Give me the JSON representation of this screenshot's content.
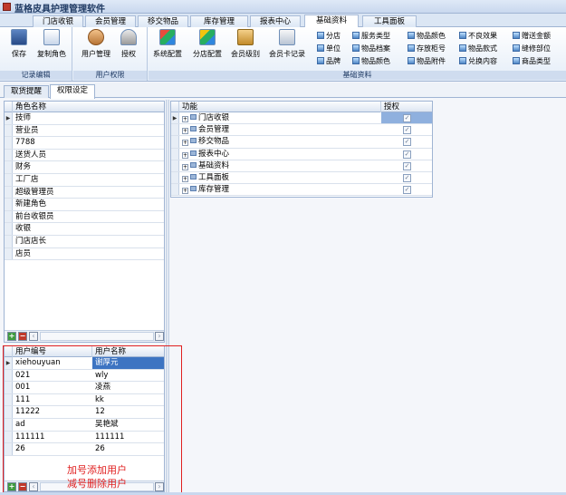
{
  "window": {
    "title": "蓝格皮具护理管理软件"
  },
  "menu_tabs": [
    {
      "label": "门店收银",
      "active": false
    },
    {
      "label": "会员管理",
      "active": false
    },
    {
      "label": "移交物品",
      "active": false
    },
    {
      "label": "库存管理",
      "active": false
    },
    {
      "label": "报表中心",
      "active": false
    },
    {
      "label": "基础资料",
      "active": true
    },
    {
      "label": "工具面板",
      "active": false
    }
  ],
  "ribbon": {
    "record_group": {
      "label": "记录编辑",
      "buttons": [
        {
          "label": "保存",
          "icon": "save-icon"
        },
        {
          "label": "复制角色",
          "icon": "copy-icon"
        }
      ]
    },
    "permission_group": {
      "label": "用户权限",
      "buttons": [
        {
          "label": "用户管理",
          "icon": "users-icon"
        },
        {
          "label": "授权",
          "icon": "key-icon"
        }
      ]
    },
    "basic_group": {
      "label": "基础资料",
      "big_buttons": [
        {
          "label": "系统配置",
          "icon": "cubes-icon"
        },
        {
          "label": "分店配置",
          "icon": "cubes-icon"
        },
        {
          "label": "会员级别",
          "icon": "person-icon"
        },
        {
          "label": "会员卡记录",
          "icon": "card-icon"
        }
      ],
      "small_buttons": [
        [
          "分店",
          "服务类型",
          "物品颜色",
          "不良效果",
          "赠送金额"
        ],
        [
          "单位",
          "物品档案",
          "存放柜号",
          "物品款式",
          "缝修部位"
        ],
        [
          "品牌",
          "物品颜色",
          "物品附件",
          "兑换内容",
          "商品类型"
        ]
      ]
    }
  },
  "page_tabs": [
    {
      "label": "取货提醒",
      "active": false
    },
    {
      "label": "权限设定",
      "active": true
    }
  ],
  "roles_grid": {
    "header": "角色名称",
    "rows": [
      "技师",
      "营业员",
      "7788",
      "送货人员",
      "财务",
      "工厂店",
      "超级管理员",
      "新建角色",
      "前台收银员",
      "收银",
      "门店店长",
      "店员"
    ]
  },
  "users_grid": {
    "headers": [
      "用户编号",
      "用户名称"
    ],
    "rows": [
      [
        "xiehouyuan",
        "谢厚元"
      ],
      [
        "021",
        "wly"
      ],
      [
        "001",
        "凌燕"
      ],
      [
        "111",
        "kk"
      ],
      [
        "11222",
        "12"
      ],
      [
        "ad",
        "吴艳斌"
      ],
      [
        "111111",
        "111111"
      ],
      [
        "26",
        "26"
      ]
    ]
  },
  "permissions_grid": {
    "headers": [
      "功能",
      "授权"
    ],
    "rows": [
      "门店收银",
      "会员管理",
      "移交物品",
      "报表中心",
      "基础资料",
      "工具面板",
      "库存管理"
    ]
  },
  "annotation": {
    "line1": "加号添加用户",
    "line2": "减号删除用户",
    "color": "#e02020"
  }
}
